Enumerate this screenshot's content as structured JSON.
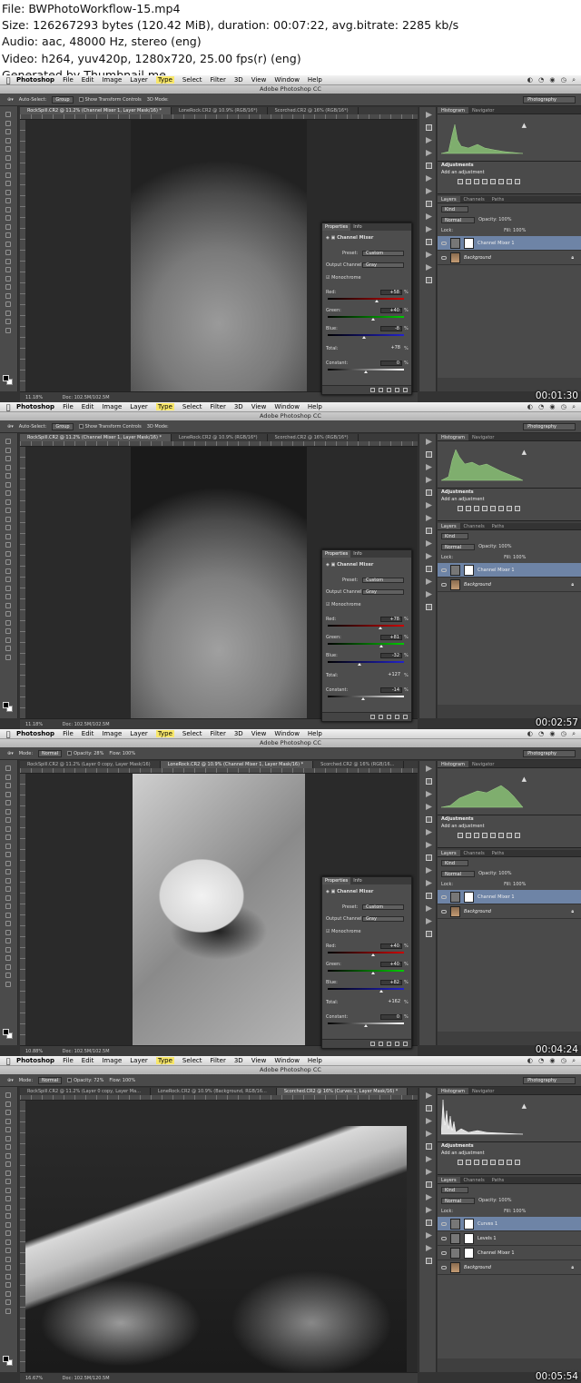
{
  "header": {
    "lines": [
      "File: BWPhotoWorkflow-15.mp4",
      "Size: 126267293 bytes (120.42 MiB), duration: 00:07:22, avg.bitrate: 2285 kb/s",
      "Audio: aac, 48000 Hz, stereo (eng)",
      "Video: h264, yuv420p, 1280x720, 25.00 fps(r) (eng)",
      "Generated by Thumbnail me"
    ]
  },
  "app": {
    "menu": [
      "Photoshop",
      "File",
      "Edit",
      "Image",
      "Layer",
      "Type",
      "Select",
      "Filter",
      "3D",
      "View",
      "Window",
      "Help"
    ],
    "window_title": "Adobe Photoshop CC",
    "workspace": "Photography"
  },
  "frames": [
    {
      "timestamp": "00:01:30",
      "options": {
        "label1": "Auto-Select:",
        "btn1": "Group",
        "label2": "Show Transform Controls",
        "mode": "3D Mode:"
      },
      "tabs": [
        "RockSpill.CR2 @ 11.2% (Channel Mixer 1, Layer Mask/16) *",
        "LoneRock.CR2 @ 10.9% (RGB/16*)",
        "Scorched.CR2 @ 16% (RGB/16*)"
      ],
      "status": {
        "zoom": "11.18%",
        "doc": "Doc: 102.5M/102.5M"
      },
      "properties": {
        "tabs": [
          "Properties",
          "Info"
        ],
        "title": "Channel Mixer",
        "preset_label": "Preset:",
        "preset": "Custom",
        "output_label": "Output Channel:",
        "output": "Gray",
        "mono": "Monochrome",
        "red_label": "Red:",
        "red": "+58",
        "green_label": "Green:",
        "green": "+40",
        "blue_label": "Blue:",
        "blue": "-8",
        "total_label": "Total:",
        "total": "+78",
        "constant_label": "Constant:",
        "constant": "0",
        "pct": "%"
      },
      "histogram_tabs": [
        "Histogram",
        "Navigator"
      ],
      "adjustments": {
        "title": "Adjustments",
        "add": "Add an adjustment"
      },
      "layers_tabs": [
        "Layers",
        "Channels",
        "Paths"
      ],
      "layers_kind": "Kind",
      "layers_blend": "Normal",
      "layers_opacity": "Opacity: 100%",
      "layers_lock": "Lock:",
      "layers_fill": "Fill: 100%",
      "layers": [
        {
          "name": "Channel Mixer 1",
          "selected": true,
          "kind": "adj"
        },
        {
          "name": "Background",
          "selected": false,
          "kind": "photo"
        }
      ]
    },
    {
      "timestamp": "00:02:57",
      "options": {
        "label1": "Auto-Select:",
        "btn1": "Group",
        "label2": "Show Transform Controls",
        "mode": "3D Mode:"
      },
      "tabs": [
        "RockSpill.CR2 @ 11.2% (Channel Mixer 1, Layer Mask/16) *",
        "LoneRock.CR2 @ 10.9% (RGB/16*)",
        "Scorched.CR2 @ 16% (RGB/16*)"
      ],
      "status": {
        "zoom": "11.18%",
        "doc": "Doc: 102.5M/102.5M"
      },
      "properties": {
        "tabs": [
          "Properties",
          "Info"
        ],
        "title": "Channel Mixer",
        "preset_label": "Preset:",
        "preset": "Custom",
        "output_label": "Output Channel:",
        "output": "Gray",
        "mono": "Monochrome",
        "red_label": "Red:",
        "red": "+78",
        "green_label": "Green:",
        "green": "+81",
        "blue_label": "Blue:",
        "blue": "-32",
        "total_label": "Total:",
        "total": "+127",
        "constant_label": "Constant:",
        "constant": "-14",
        "pct": "%"
      },
      "histogram_tabs": [
        "Histogram",
        "Navigator"
      ],
      "adjustments": {
        "title": "Adjustments",
        "add": "Add an adjustment"
      },
      "layers_tabs": [
        "Layers",
        "Channels",
        "Paths"
      ],
      "layers_kind": "Kind",
      "layers_blend": "Normal",
      "layers_opacity": "Opacity: 100%",
      "layers_lock": "Lock:",
      "layers_fill": "Fill: 100%",
      "layers": [
        {
          "name": "Channel Mixer 1",
          "selected": true,
          "kind": "adj"
        },
        {
          "name": "Background",
          "selected": false,
          "kind": "photo"
        }
      ]
    },
    {
      "timestamp": "00:04:24",
      "options": {
        "label1": "Mode:",
        "btn1": "Normal",
        "label2": "Opacity: 28%",
        "mode": "Flow: 100%"
      },
      "tabs": [
        "RockSpill.CR2 @ 11.2% (Layer 0 copy, Layer Mask/16)",
        "LoneRock.CR2 @ 10.9% (Channel Mixer 1, Layer Mask/16) *",
        "Scorched.CR2 @ 16% (RGB/16..."
      ],
      "status": {
        "zoom": "10.88%",
        "doc": "Doc: 102.5M/102.5M"
      },
      "properties": {
        "tabs": [
          "Properties",
          "Info"
        ],
        "title": "Channel Mixer",
        "preset_label": "Preset:",
        "preset": "Custom",
        "output_label": "Output Channel:",
        "output": "Gray",
        "mono": "Monochrome",
        "red_label": "Red:",
        "red": "+40",
        "green_label": "Green:",
        "green": "+40",
        "blue_label": "Blue:",
        "blue": "+82",
        "total_label": "Total:",
        "total": "+162",
        "constant_label": "Constant:",
        "constant": "0",
        "pct": "%"
      },
      "histogram_tabs": [
        "Histogram",
        "Navigator"
      ],
      "adjustments": {
        "title": "Adjustments",
        "add": "Add an adjustment"
      },
      "layers_tabs": [
        "Layers",
        "Channels",
        "Paths"
      ],
      "layers_kind": "Kind",
      "layers_blend": "Normal",
      "layers_opacity": "Opacity: 100%",
      "layers_lock": "Lock:",
      "layers_fill": "Fill: 100%",
      "layers": [
        {
          "name": "Channel Mixer 1",
          "selected": true,
          "kind": "adj"
        },
        {
          "name": "Background",
          "selected": false,
          "kind": "photo"
        }
      ]
    },
    {
      "timestamp": "00:05:54",
      "options": {
        "label1": "Mode:",
        "btn1": "Normal",
        "label2": "Opacity: 72%",
        "mode": "Flow: 100%"
      },
      "tabs": [
        "RockSpill.CR2 @ 11.2% (Layer 0 copy, Layer Ma...",
        "LoneRock.CR2 @ 10.9% (Background, RGB/16...",
        "Scorched.CR2 @ 16% (Curves 1, Layer Mask/16) *"
      ],
      "status": {
        "zoom": "16.67%",
        "doc": "Doc: 102.5M/120.5M"
      },
      "properties": null,
      "histogram_tabs": [
        "Histogram",
        "Navigator"
      ],
      "adjustments": {
        "title": "Adjustments",
        "add": "Add an adjustment"
      },
      "layers_tabs": [
        "Layers",
        "Channels",
        "Paths"
      ],
      "layers_kind": "Kind",
      "layers_blend": "Normal",
      "layers_opacity": "Opacity: 100%",
      "layers_lock": "Lock:",
      "layers_fill": "Fill: 100%",
      "layers": [
        {
          "name": "Curves 1",
          "selected": true,
          "kind": "adj"
        },
        {
          "name": "Levels 1",
          "selected": false,
          "kind": "adj"
        },
        {
          "name": "Channel Mixer 1",
          "selected": false,
          "kind": "adj"
        },
        {
          "name": "Background",
          "selected": false,
          "kind": "photo"
        }
      ]
    }
  ]
}
